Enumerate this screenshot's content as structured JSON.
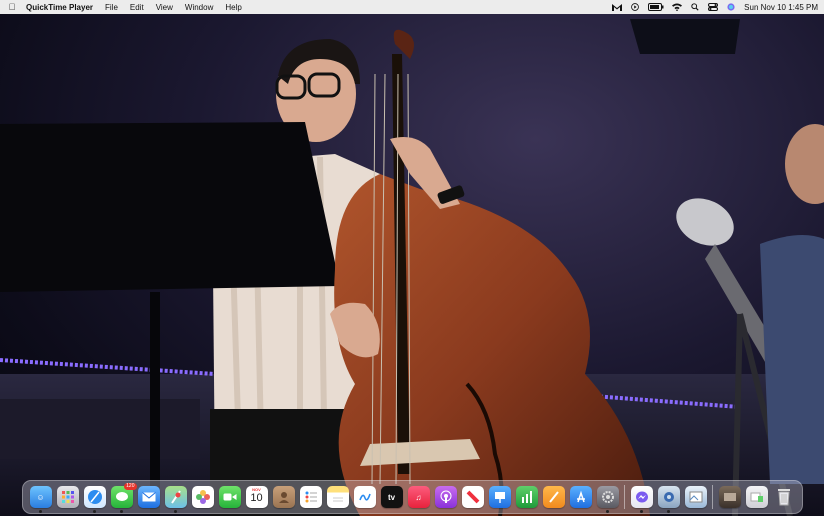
{
  "menubar": {
    "app_name": "QuickTime Player",
    "menus": [
      "File",
      "Edit",
      "View",
      "Window",
      "Help"
    ],
    "clock": "Sun Nov 10  1:45 PM"
  },
  "dock": {
    "messages_badge": "120",
    "calendar_month": "NOV",
    "calendar_day": "10",
    "apple_tv_label": "tv",
    "apps": [
      "Finder",
      "Launchpad",
      "Safari",
      "Messages",
      "Mail",
      "Maps",
      "Photos",
      "FaceTime",
      "Calendar",
      "Contacts",
      "Reminders",
      "Notes",
      "Freeform",
      "TV",
      "Music",
      "Podcasts",
      "News",
      "Keynote",
      "Numbers",
      "Pages",
      "App Store",
      "System Settings",
      "Messenger",
      "Screen Sharing",
      "Preview",
      "Downloads",
      "Trash"
    ]
  },
  "colors": {
    "menubar_bg": "#ececec",
    "led_strip": "#8a6cff",
    "cello": "#8a3a1e"
  }
}
